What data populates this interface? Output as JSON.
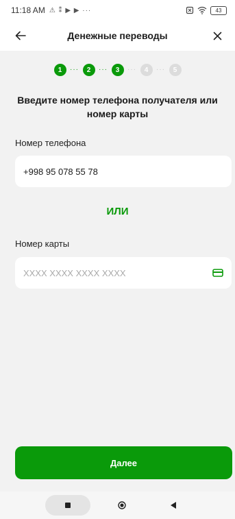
{
  "status_bar": {
    "time": "11:18 AM",
    "left_glyphs": "⚠ ⁑ ▶ ▶ ···",
    "battery": "43"
  },
  "header": {
    "title": "Денежные переводы",
    "back_icon": "arrow-left-icon",
    "close_icon": "close-icon"
  },
  "stepper": {
    "current_step": 3,
    "total_steps": 5,
    "steps": [
      {
        "label": "1",
        "state": "completed"
      },
      {
        "label": "2",
        "state": "completed"
      },
      {
        "label": "3",
        "state": "current"
      },
      {
        "label": "4",
        "state": "upcoming"
      },
      {
        "label": "5",
        "state": "upcoming"
      }
    ]
  },
  "form": {
    "heading": "Введите номер телефона получателя или номер карты",
    "phone": {
      "label": "Номер телефона",
      "value": "+998 95 078 55 78"
    },
    "or_text": "ИЛИ",
    "card": {
      "label": "Номер карты",
      "placeholder": "XXXX XXXX XXXX XXXX",
      "icon": "credit-card-icon"
    }
  },
  "actions": {
    "next_label": "Далее"
  },
  "colors": {
    "accent": "#0a9a0a",
    "background": "#f2f2f2",
    "surface": "#ffffff"
  }
}
